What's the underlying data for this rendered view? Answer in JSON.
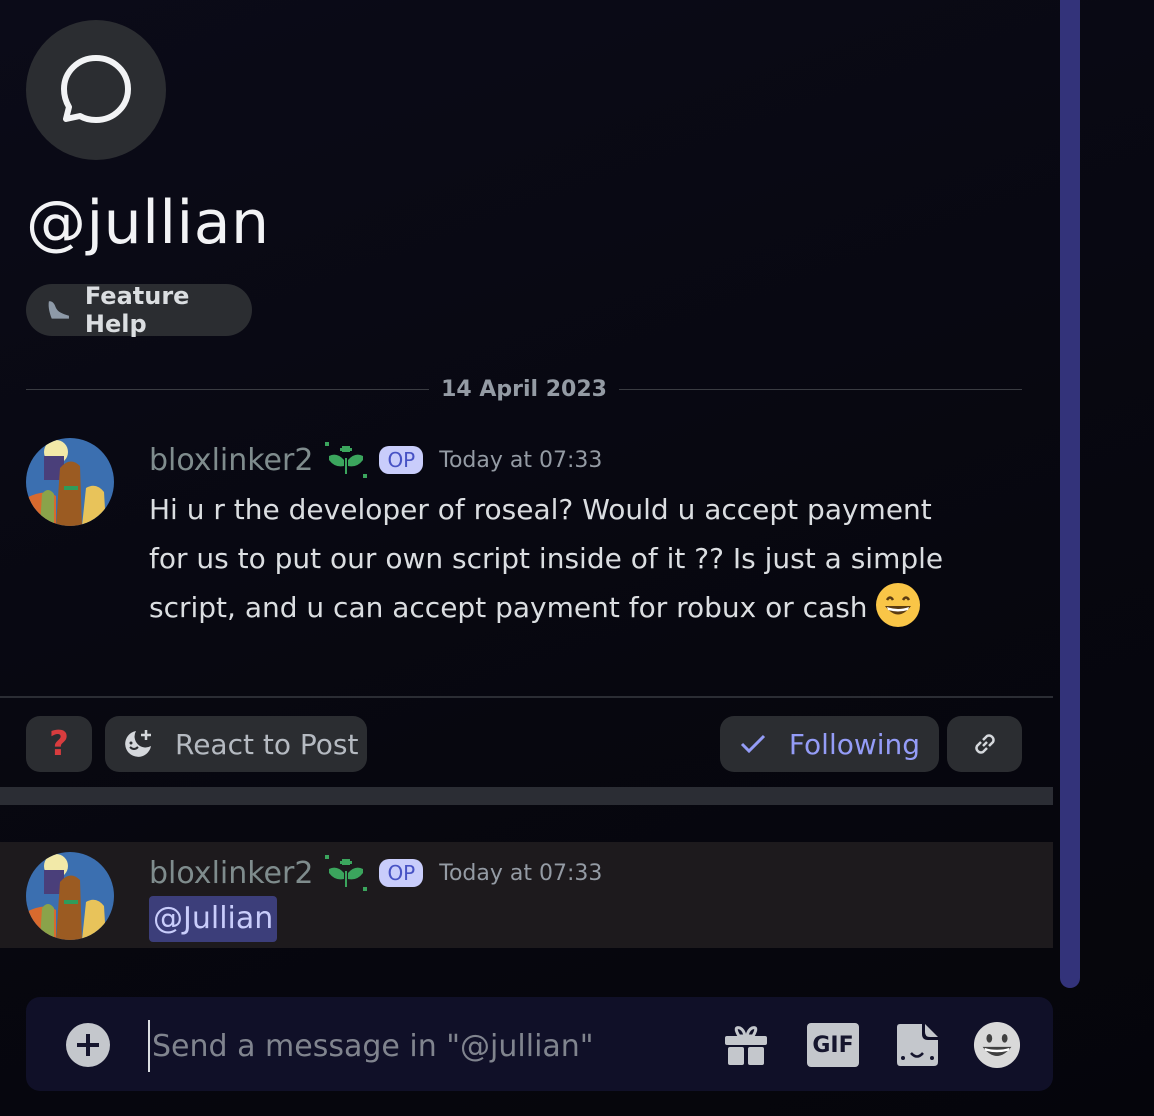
{
  "thread": {
    "title": "@jullian",
    "icon": "chat-bubble-icon",
    "tag": {
      "label": "Feature Help",
      "icon": "seal-icon"
    }
  },
  "date_divider": "14 April 2023",
  "messages": [
    {
      "author": "bloxlinker2",
      "author_badge_icon": "sprout-icon",
      "op_badge": "OP",
      "timestamp": "Today at 07:33",
      "text": "Hi u r the developer of roseal? Would u accept payment for us to put our own script inside of it ?? Is just a simple script, and u can accept payment for robux or cash",
      "emoji": "grinning-face-emoji"
    },
    {
      "author": "bloxlinker2",
      "author_badge_icon": "sprout-icon",
      "op_badge": "OP",
      "timestamp": "Today at 07:33",
      "mention": "@Jullian"
    }
  ],
  "post_actions": {
    "tag_reaction_icon": "question-mark-icon",
    "react_label": "React to Post",
    "following_label": "Following",
    "copy_link_icon": "link-icon"
  },
  "composer": {
    "placeholder": "Send a message in \"@jullian\"",
    "value": "",
    "buttons": [
      "add-attachment",
      "gift",
      "gif",
      "sticker",
      "emoji"
    ],
    "gif_label": "GIF"
  },
  "colors": {
    "accent": "#949cf7",
    "op_badge_bg": "#c9cdfb",
    "mention_bg": "#3c3e7a",
    "scrollbar": "#33337a",
    "question_red": "#d83c3e"
  }
}
